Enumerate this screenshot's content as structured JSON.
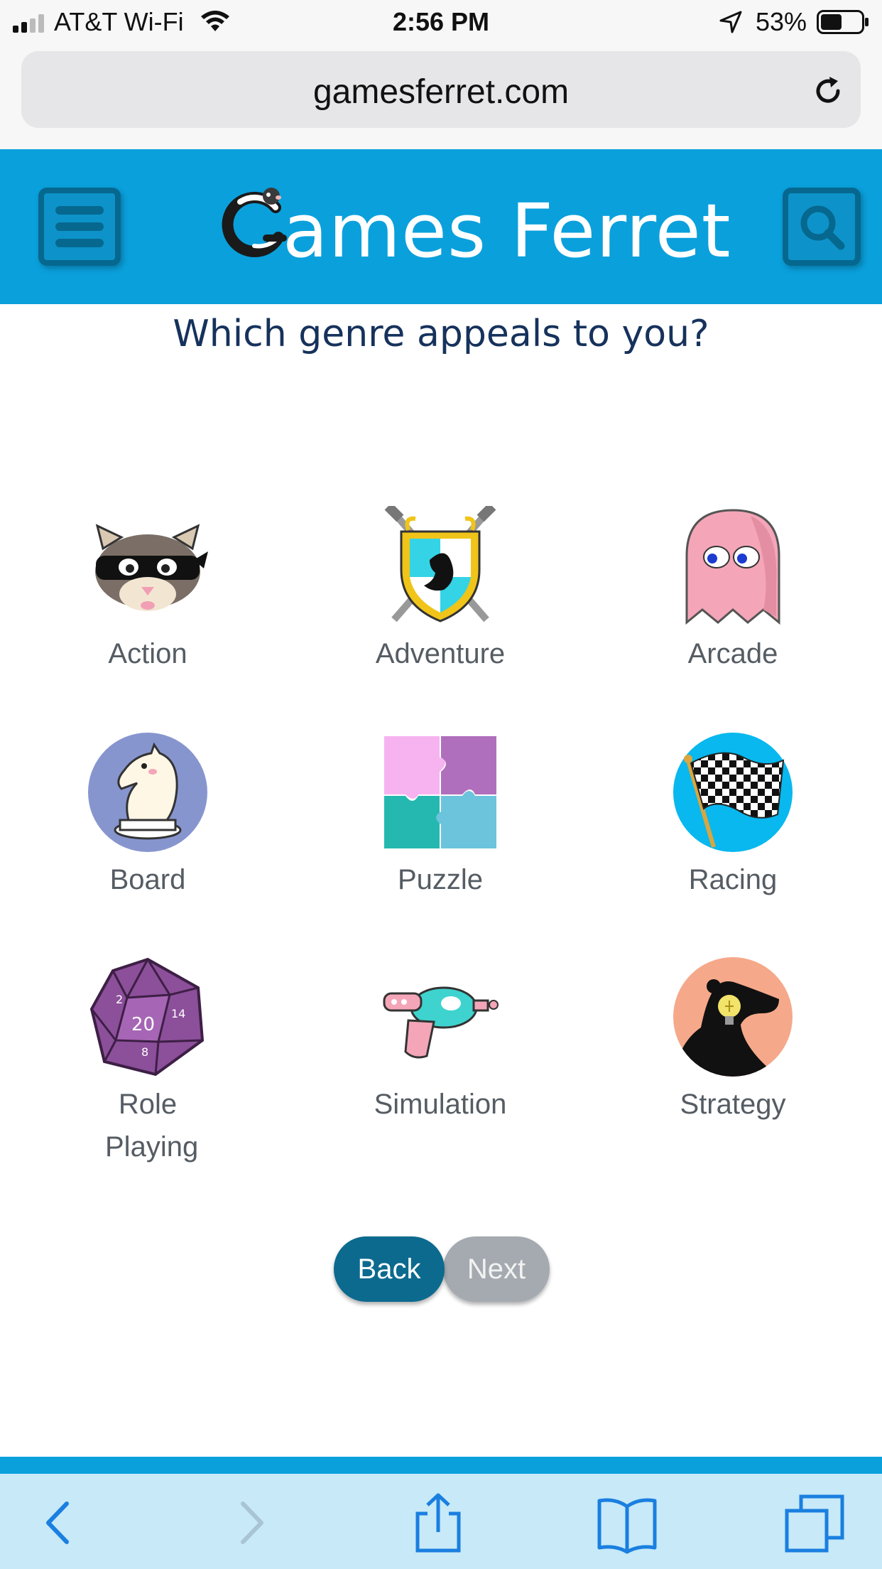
{
  "status_bar": {
    "carrier": "AT&T Wi-Fi",
    "time": "2:56 PM",
    "battery_percent": "53%",
    "battery_level": 0.53,
    "icons": [
      "signal-icon",
      "wifi-icon",
      "location-arrow-icon",
      "battery-icon"
    ]
  },
  "browser": {
    "url": "gamesferret.com",
    "icons": [
      "reload-icon",
      "back-arrow-icon",
      "forward-arrow-icon",
      "share-icon",
      "bookmarks-icon",
      "tabs-icon"
    ]
  },
  "header": {
    "site_title": "ames Ferret",
    "brand_color": "#0aa0dc",
    "dark_color": "#06688f",
    "icons": [
      "menu-icon",
      "ferret-logo-icon",
      "search-icon"
    ]
  },
  "question": "Which genre appeals to you?",
  "genres": [
    {
      "label": "Action",
      "icon": "ninja-ferret-icon"
    },
    {
      "label": "Adventure",
      "icon": "shield-swords-icon"
    },
    {
      "label": "Arcade",
      "icon": "ghost-icon"
    },
    {
      "label": "Board",
      "icon": "chess-knight-icon"
    },
    {
      "label": "Puzzle",
      "icon": "puzzle-pieces-icon"
    },
    {
      "label": "Racing",
      "icon": "checkered-flag-icon"
    },
    {
      "label": "Role Playing",
      "icon": "d20-dice-icon"
    },
    {
      "label": "Simulation",
      "icon": "ray-gun-icon"
    },
    {
      "label": "Strategy",
      "icon": "ferret-lightbulb-icon"
    }
  ],
  "buttons": {
    "back": "Back",
    "next": "Next"
  }
}
